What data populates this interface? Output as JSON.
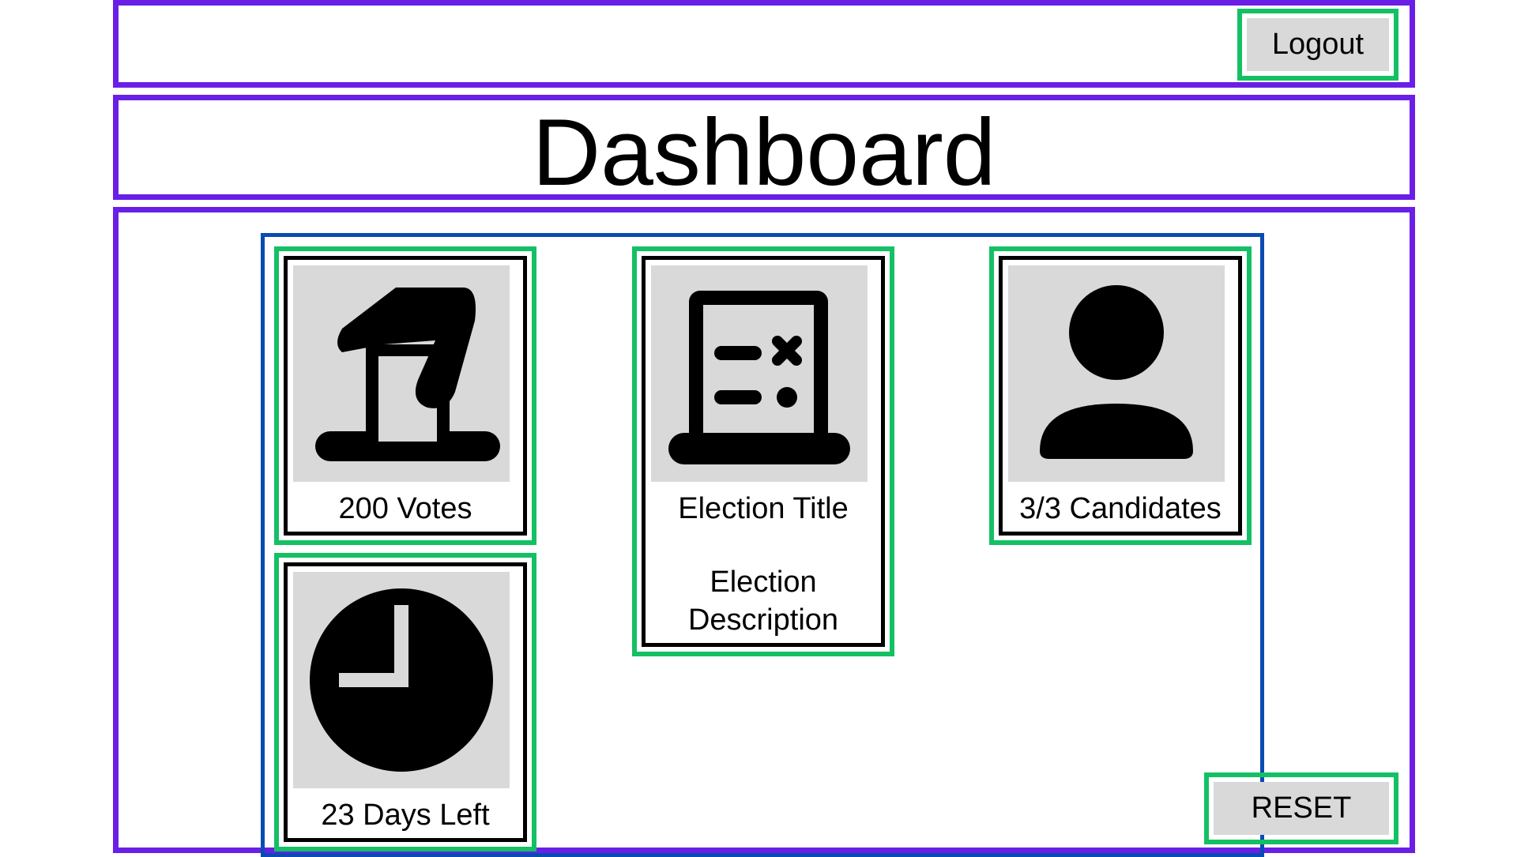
{
  "header": {
    "logout_label": "Logout"
  },
  "page": {
    "title": "Dashboard"
  },
  "cards": {
    "votes": {
      "label": "200 Votes",
      "icon": "ballot-box-icon"
    },
    "election": {
      "title": "Election Title",
      "description": "Election\nDescription",
      "icon": "ballot-icon"
    },
    "candidates": {
      "label": "3/3 Candidates",
      "icon": "person-icon"
    },
    "time": {
      "label": "23 Days Left",
      "icon": "clock-icon"
    }
  },
  "actions": {
    "reset_label": "RESET"
  },
  "colors": {
    "frame": "#6a1fe6",
    "container": "#0a4bb3",
    "highlight": "#14c064",
    "icon_bg": "#d9d9d9"
  }
}
